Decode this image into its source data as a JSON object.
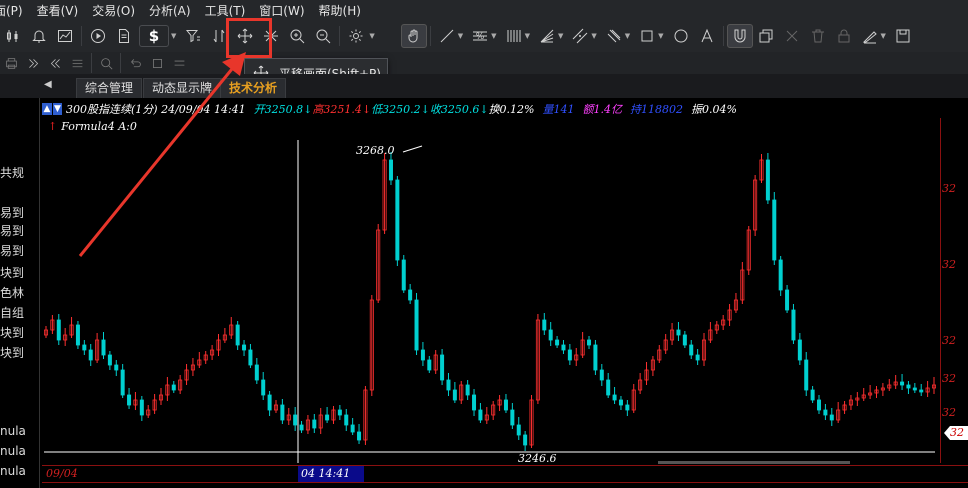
{
  "menu": [
    "面(P)",
    "查看(V)",
    "交易(O)",
    "分析(A)",
    "工具(T)",
    "窗口(W)",
    "帮助(H)"
  ],
  "toolbar": {
    "dollar_label": "$",
    "pan_tooltip": "平移画面(Shift+P)"
  },
  "tabs": [
    "综合管理",
    "动态显示牌",
    "技术分析"
  ],
  "left_panel": [
    "共规",
    "易到",
    "易到",
    "易到",
    "块到",
    "色林",
    "自组",
    "块到",
    "块到",
    "nula",
    "nula",
    "nula"
  ],
  "left_panel_header": "平",
  "infobar": {
    "badge1": "▲",
    "badge2": "▼",
    "title": "300股指连续(1分) 24/09/04 14:41",
    "open": "开3250.8↓",
    "high": "高3251.4↓",
    "low": "低3250.2↓",
    "close": "收3250.6↓",
    "change": "换0.12%",
    "volume": "量141",
    "amount": "额1.4亿",
    "hold": "持118802",
    "amplitude": "振0.04%"
  },
  "formula": {
    "name": "Formula4",
    "value": "A:0"
  },
  "annotations": {
    "high_label": "3268.0",
    "low_label": "3246.6"
  },
  "right_axis_ticks": [
    "32",
    "32",
    "32",
    "32",
    "32"
  ],
  "right_axis_current": "32",
  "bottom_axis": {
    "date": "09/04",
    "cursor_time": "04 14:41"
  },
  "colors": {
    "up": "#ff3030",
    "down": "#00d0d0",
    "highlight": "#e8362b"
  },
  "chart_data": {
    "type": "candlestick",
    "high": 3268.0,
    "low": 3246.6
  }
}
